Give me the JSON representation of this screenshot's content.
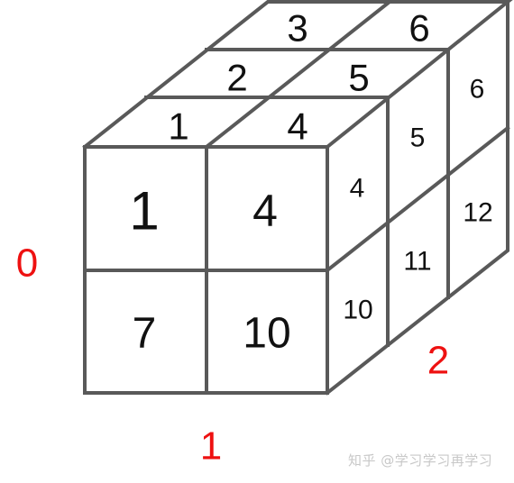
{
  "front": [
    "1",
    "4",
    "7",
    "10"
  ],
  "top": {
    "row_front": [
      "1",
      "4"
    ],
    "row_mid": [
      "2",
      "5"
    ],
    "row_back": [
      "3",
      "6"
    ]
  },
  "side": {
    "upper": [
      "4",
      "5",
      "6"
    ],
    "lower": [
      "10",
      "11",
      "12"
    ]
  },
  "axes": {
    "axis0": "0",
    "axis1": "1",
    "axis2": "2"
  },
  "watermark": "知乎 @学习学习再学习",
  "colors": {
    "line": "#595959",
    "axis_label": "#ee1111"
  }
}
